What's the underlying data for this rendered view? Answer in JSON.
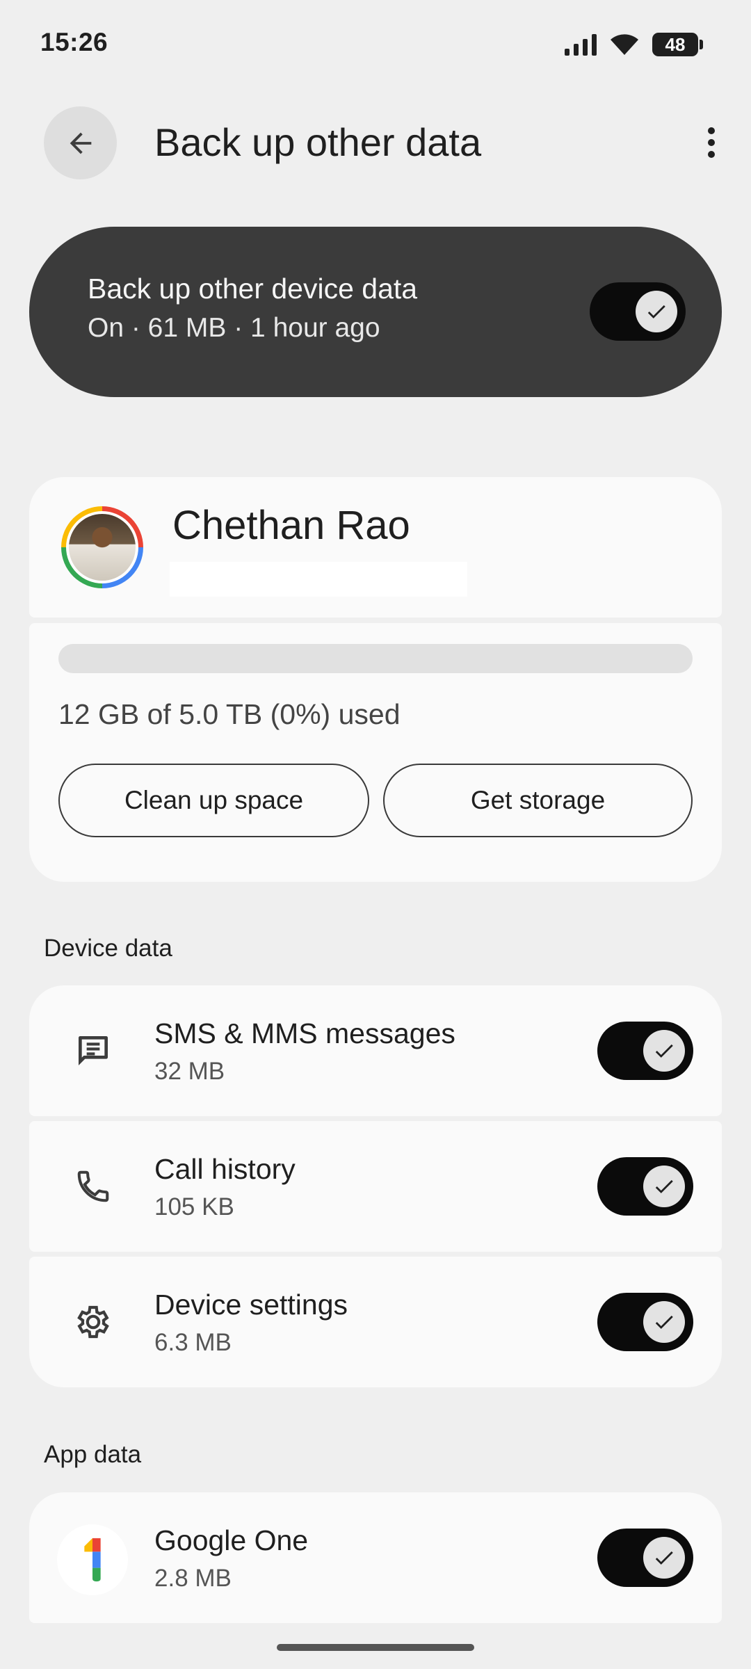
{
  "status_bar": {
    "time": "15:26",
    "battery": "48"
  },
  "header": {
    "title": "Back up other data",
    "back_icon": "arrow-back-icon",
    "more_icon": "more-vert-icon"
  },
  "master": {
    "title": "Back up other device data",
    "subtitle": "On · 61 MB · 1 hour ago",
    "enabled": true
  },
  "account": {
    "name": "Chethan Rao",
    "storage_text": "12 GB of 5.0 TB (0%) used",
    "storage_used_fraction": 0.0,
    "clean_up_label": "Clean up space",
    "get_storage_label": "Get storage"
  },
  "device_data": {
    "header": "Device data",
    "items": [
      {
        "title": "SMS & MMS messages",
        "size": "32 MB",
        "icon": "message-icon",
        "enabled": true
      },
      {
        "title": "Call history",
        "size": "105 KB",
        "icon": "phone-icon",
        "enabled": true
      },
      {
        "title": "Device settings",
        "size": "6.3 MB",
        "icon": "gear-icon",
        "enabled": true
      }
    ]
  },
  "app_data": {
    "header": "App data",
    "items": [
      {
        "title": "Google One",
        "size": "2.8 MB",
        "icon": "google-one-icon",
        "enabled": true
      }
    ]
  },
  "colors": {
    "background": "#efefef",
    "master_card": "#3b3b3b",
    "toggle_track": "#0b0b0b",
    "card": "#fafafa"
  }
}
